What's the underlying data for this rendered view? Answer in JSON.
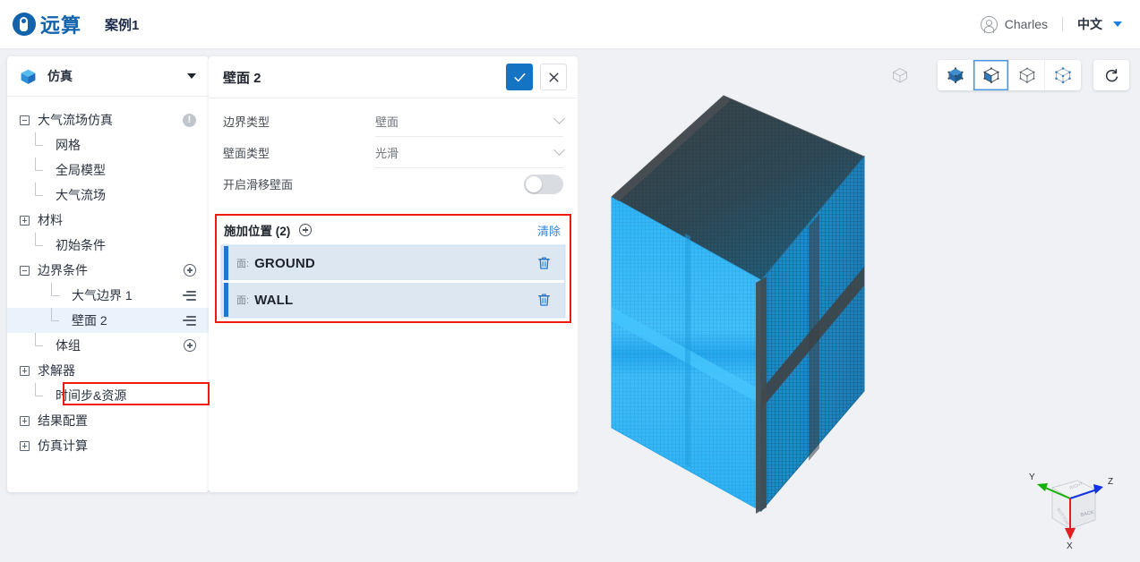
{
  "header": {
    "logo_text": "远算",
    "case_title": "案例1",
    "user_name": "Charles",
    "language": "中文",
    "avatar_icon": "user-circle-icon",
    "lang_caret_icon": "caret-down-icon"
  },
  "tree_panel": {
    "head_label": "仿真",
    "head_icon": "cube-icon",
    "caret_icon": "caret-down-icon",
    "items": [
      {
        "label": "大气流场仿真",
        "toggle": "minus",
        "depth": 0,
        "trailing": "warning-badge",
        "trailing_text": "!",
        "selected": false
      },
      {
        "label": "网格",
        "toggle": "stub",
        "depth": 1,
        "trailing": "none",
        "trailing_text": "",
        "selected": false
      },
      {
        "label": "全局模型",
        "toggle": "stub",
        "depth": 1,
        "trailing": "none",
        "trailing_text": "",
        "selected": false
      },
      {
        "label": "大气流场",
        "toggle": "stub",
        "depth": 1,
        "trailing": "none",
        "trailing_text": "",
        "selected": false
      },
      {
        "label": "材料",
        "toggle": "plus",
        "depth": 0,
        "trailing": "none",
        "trailing_text": "",
        "selected": false
      },
      {
        "label": "初始条件",
        "toggle": "stub",
        "depth": 1,
        "trailing": "none",
        "trailing_text": "",
        "selected": false
      },
      {
        "label": "边界条件",
        "toggle": "minus",
        "depth": 0,
        "trailing": "plus-circle",
        "trailing_text": "",
        "selected": false
      },
      {
        "label": "大气边界 1",
        "toggle": "stub",
        "depth": 2,
        "trailing": "lines",
        "trailing_text": "",
        "selected": false
      },
      {
        "label": "壁面 2",
        "toggle": "stub",
        "depth": 2,
        "trailing": "lines",
        "trailing_text": "",
        "selected": true
      },
      {
        "label": "体组",
        "toggle": "stub",
        "depth": 1,
        "trailing": "plus-circle",
        "trailing_text": "",
        "selected": false
      },
      {
        "label": "求解器",
        "toggle": "plus",
        "depth": 0,
        "trailing": "none",
        "trailing_text": "",
        "selected": false
      },
      {
        "label": "时间步&资源",
        "toggle": "stub",
        "depth": 1,
        "trailing": "none",
        "trailing_text": "",
        "selected": false
      },
      {
        "label": "结果配置",
        "toggle": "plus",
        "depth": 0,
        "trailing": "none",
        "trailing_text": "",
        "selected": false
      },
      {
        "label": "仿真计算",
        "toggle": "plus",
        "depth": 0,
        "trailing": "none",
        "trailing_text": "",
        "selected": false
      }
    ]
  },
  "props_panel": {
    "title": "壁面 2",
    "confirm_icon": "check-icon",
    "cancel_icon": "close-icon",
    "fields": [
      {
        "label": "边界类型",
        "value": "壁面",
        "control": "select"
      },
      {
        "label": "壁面类型",
        "value": "光滑",
        "control": "select"
      },
      {
        "label": "开启滑移壁面",
        "value": "off",
        "control": "toggle"
      }
    ],
    "assignment": {
      "title": "施加位置 (2)",
      "add_icon": "plus-circle-icon",
      "clear_label": "清除",
      "items": [
        {
          "prefix": "面:",
          "name": "GROUND",
          "delete_icon": "trash-icon"
        },
        {
          "prefix": "面:",
          "name": "WALL",
          "delete_icon": "trash-icon"
        }
      ]
    }
  },
  "viewport": {
    "toolbar": [
      {
        "name": "cube-outline-ghost-icon",
        "style": "ghost",
        "active": false
      },
      {
        "name": "cube-solid-icon",
        "style": "grouped",
        "active": false
      },
      {
        "name": "cube-half-shaded-icon",
        "style": "grouped",
        "active": true
      },
      {
        "name": "cube-wireframe-icon",
        "style": "grouped",
        "active": false
      },
      {
        "name": "cube-points-icon",
        "style": "grouped",
        "active": false
      },
      {
        "name": "reset-view-icon",
        "style": "single",
        "active": false
      }
    ],
    "axis_gizmo": {
      "name": "axis-gizmo",
      "labels": {
        "x": "X",
        "y": "Y",
        "z": "Z"
      },
      "colors": {
        "x": "#e02020",
        "y": "#12b000",
        "z": "#1233e0"
      },
      "face_labels": [
        "BACK"
      ]
    },
    "model": {
      "name": "mesh-model",
      "mesh_color": "#29b2f5",
      "shade_color": "#4a4a4a",
      "background": "#eff1f5"
    }
  },
  "colors": {
    "accent": "#1573c4",
    "brand": "#1163ab",
    "highlight_outline": "#f01b0f",
    "selection_bar": "#1f77d0",
    "selection_bg": "#dce7f2",
    "panel_bg": "#ffffff",
    "page_bg": "#eff1f5"
  }
}
